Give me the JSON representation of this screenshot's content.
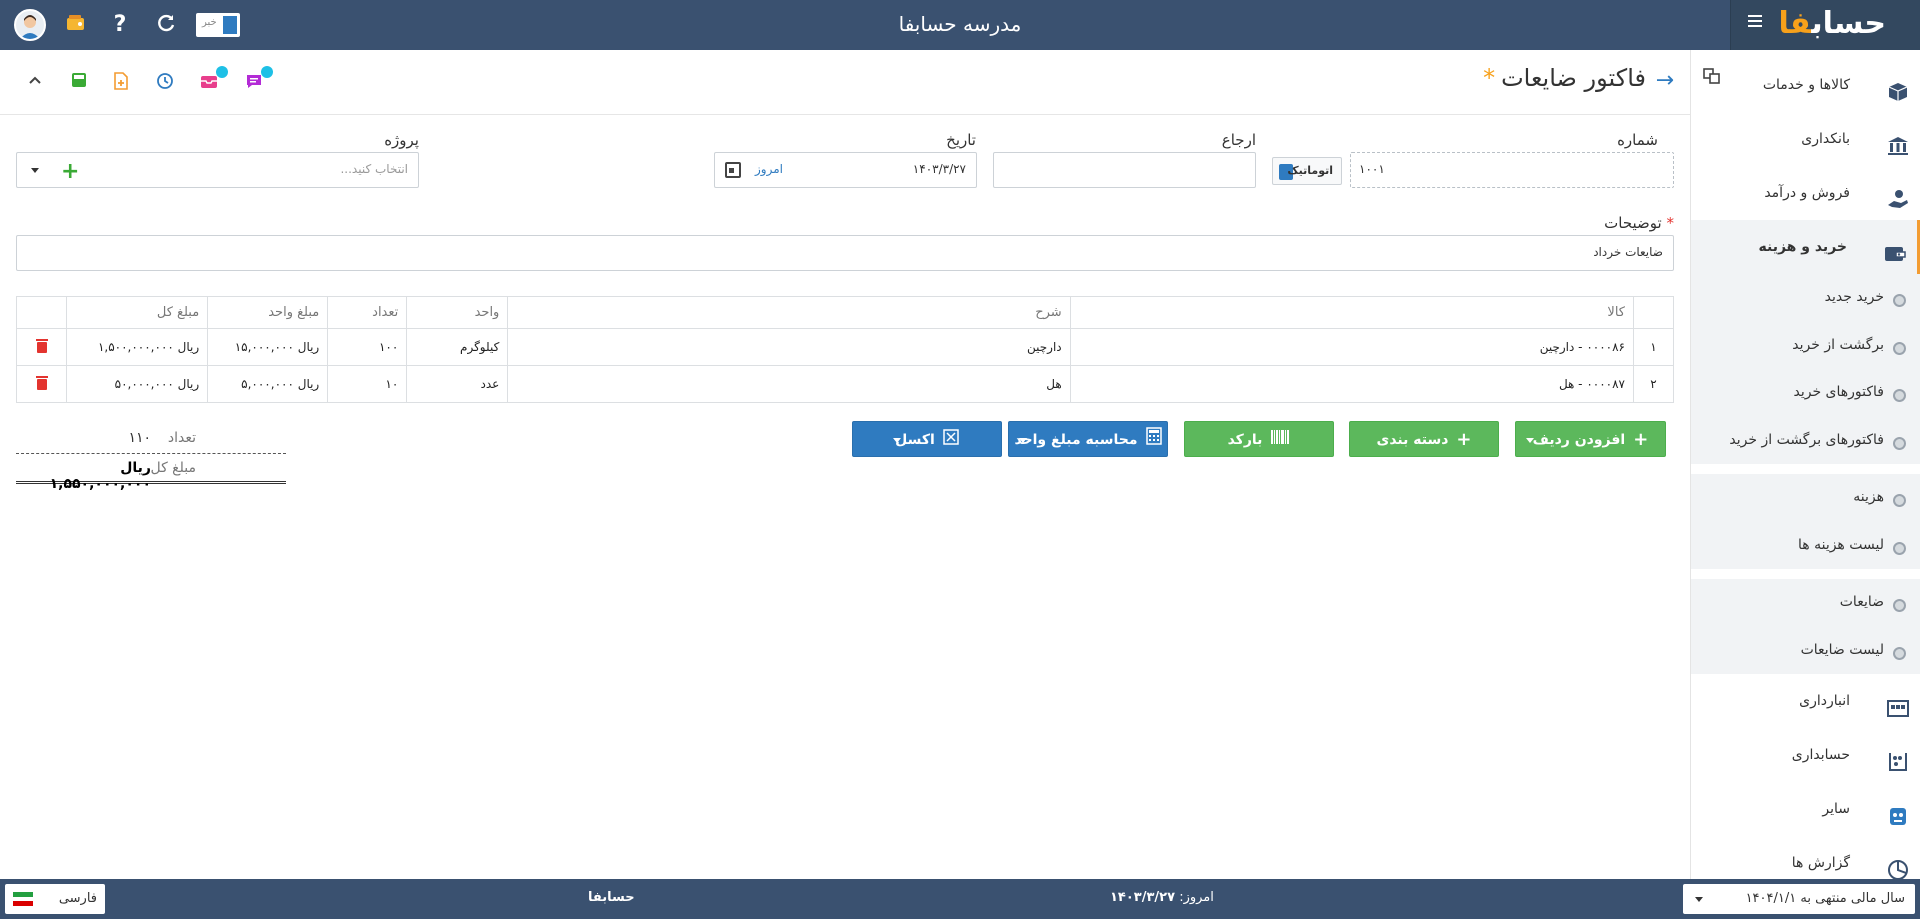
{
  "topbar": {
    "title": "مدرسه حسابفا",
    "logo_main": "حساب",
    "logo_accent": "فا",
    "news_label": "خبر"
  },
  "sidebar": {
    "items": [
      {
        "label": "کالاها و خدمات",
        "icon": "box-icon"
      },
      {
        "label": "بانکداری",
        "icon": "bank-icon"
      },
      {
        "label": "فروش و درآمد",
        "icon": "hand-money-icon"
      },
      {
        "label": "خرید و هزینه",
        "icon": "wallet-icon"
      }
    ],
    "purchase_sub": [
      "خرید جدید",
      "برگشت از خرید",
      "فاکتورهای خرید",
      "فاکتورهای برگشت از خرید"
    ],
    "expense_sub": [
      "هزینه",
      "لیست هزینه ها"
    ],
    "waste_sub": [
      "ضایعات",
      "لیست ضایعات"
    ],
    "bottom_items": [
      {
        "label": "انبارداری",
        "icon": "warehouse-icon"
      },
      {
        "label": "حسابداری",
        "icon": "abacus-icon"
      },
      {
        "label": "سایر",
        "icon": "misc-icon"
      },
      {
        "label": "گزارش ها",
        "icon": "report-icon"
      }
    ]
  },
  "header": {
    "page_title": "فاکتور ضایعات",
    "star": "*"
  },
  "form": {
    "number_label": "شماره",
    "number_value": "۱۰۰۱",
    "auto_label": "اتوماتیک",
    "reference_label": "ارجاع",
    "reference_value": "",
    "date_label": "تاریخ",
    "date_value": "۱۴۰۳/۳/۲۷",
    "today_link": "امروز",
    "project_label": "پروژه",
    "project_placeholder": "انتخاب کنید...",
    "description_label": "توضیحات",
    "description_value": "ضایعات خرداد"
  },
  "table": {
    "headers": [
      "",
      "کالا",
      "شرح",
      "واحد",
      "تعداد",
      "مبلغ واحد",
      "مبلغ کل",
      ""
    ],
    "rows": [
      {
        "index": "۱",
        "item": "۰۰۰۰۸۶ - دارچین",
        "desc": "دارچین",
        "unit": "کیلوگرم",
        "qty": "۱۰۰",
        "unit_price": "ریال ۱۵,۰۰۰,۰۰۰",
        "total": "ریال ۱,۵۰۰,۰۰۰,۰۰۰"
      },
      {
        "index": "۲",
        "item": "۰۰۰۰۸۷ - هل",
        "desc": "هل",
        "unit": "عدد",
        "qty": "۱۰",
        "unit_price": "ریال ۵,۰۰۰,۰۰۰",
        "total": "ریال ۵۰,۰۰۰,۰۰۰"
      }
    ]
  },
  "buttons": {
    "add_row": "افزودن ردیف",
    "categorize": "دسته بندی",
    "barcode": "بارکد",
    "calc_unit_price": "محاسبه مبلغ واحد",
    "excel": "اکسل"
  },
  "totals": {
    "qty_label": "تعداد",
    "qty_value": "۱۱۰",
    "sum_label": "مبلغ کل",
    "sum_value": "ریال ۱,۵۵۰,۰۰۰,۰۰۰"
  },
  "footer": {
    "fiscal_year": "سال مالی منتهی به ۱۴۰۴/۱/۱",
    "today_label": "امروز:",
    "today_value": "۱۴۰۳/۳/۲۷",
    "brand": "حسابفا",
    "language": "فارسی"
  },
  "colors": {
    "topbar": "#3a5170",
    "primary_blue": "#2f7bc0",
    "success_green": "#5cb85c",
    "accent_orange": "#f7a11b",
    "danger_red": "#e3342f"
  }
}
